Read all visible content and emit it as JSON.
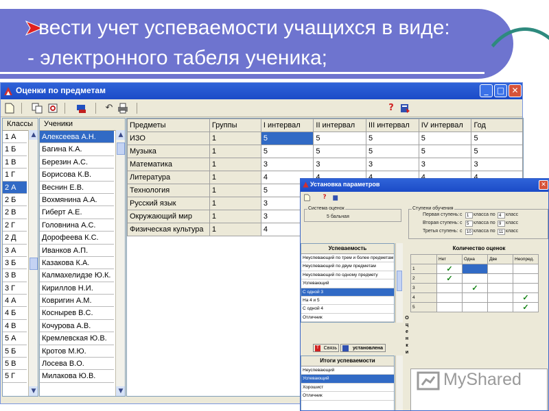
{
  "heading": {
    "line1": "вести учет успеваемости учащихся в виде:",
    "line2": "- электронного табеля ученика;"
  },
  "colors": {
    "banner": "#6e74cf",
    "selection": "#316ac5",
    "titlebar": "#2160d0",
    "check": "#108010",
    "bullet": "#e02020"
  },
  "window": {
    "title": "Оценки по предметам",
    "toolbar_icons": [
      "new-document-icon",
      "copy-icon",
      "refresh-icon",
      "print-preview-icon",
      "undo-icon",
      "printer-icon",
      "help-icon",
      "book-icon"
    ],
    "classes": {
      "header": "Классы",
      "items": [
        "1 А",
        "1 Б",
        "1 В",
        "1 Г",
        "2 А",
        "2 Б",
        "2 В",
        "2 Г",
        "2 Д",
        "3 А",
        "3 Б",
        "3 В",
        "3 Г",
        "4 А",
        "4 Б",
        "4 В",
        "5 А",
        "5 Б",
        "5 В",
        "5 Г"
      ],
      "selected": "2 А"
    },
    "students": {
      "header": "Ученики",
      "items": [
        "Алексеева А.Н.",
        "Багина К.А.",
        "Березин А.С.",
        "Борисова К.В.",
        "Веснин Е.В.",
        "Вохмянина А.А.",
        "Гиберт А.Е.",
        "Головнина А.С.",
        "Дорофеева К.С.",
        "Иванков А.П.",
        "Казакова К.А.",
        "Калмахелидзе Ю.К.",
        "Кириллов Н.И.",
        "Ковригин А.М.",
        "Коснырев В.С.",
        "Кочурова А.В.",
        "Кремлевская Ю.В.",
        "Кротов М.Ю.",
        "Лосева В.О.",
        "Милакова Ю.В."
      ],
      "selected": "Алексеева А.Н."
    },
    "grades": {
      "columns": [
        "Предметы",
        "Группы",
        "I интервал",
        "II интервал",
        "III интервал",
        "IV интервал",
        "Год"
      ],
      "rows": [
        [
          "ИЗО",
          "1",
          "5",
          "5",
          "5",
          "5",
          "5"
        ],
        [
          "Музыка",
          "1",
          "5",
          "5",
          "5",
          "5",
          "5"
        ],
        [
          "Математика",
          "1",
          "3",
          "3",
          "3",
          "3",
          "3"
        ],
        [
          "Литература",
          "1",
          "4",
          "4",
          "4",
          "4",
          "4"
        ],
        [
          "Технология",
          "1",
          "5",
          "",
          "",
          "",
          ""
        ],
        [
          "Русский язык",
          "1",
          "3",
          "",
          "",
          "",
          ""
        ],
        [
          "Окружающий мир",
          "1",
          "3",
          "",
          "",
          "",
          ""
        ],
        [
          "Физическая культура",
          "1",
          "4",
          "",
          "",
          "",
          ""
        ]
      ]
    }
  },
  "dialog": {
    "title": "Установка параметров",
    "grading_system": {
      "label": "Система оценок",
      "value": "5 бальная"
    },
    "levels": {
      "label": "Ступени обучения",
      "rows": [
        {
          "name": "Первая ступень:",
          "from_label": "с",
          "from": "1",
          "mid": "класса по",
          "to": "4",
          "unit": "класс"
        },
        {
          "name": "Вторая ступень:",
          "from_label": "с",
          "from": "5",
          "mid": "класса по",
          "to": "9",
          "unit": "класс"
        },
        {
          "name": "Третья ступень:",
          "from_label": "с",
          "from": "10",
          "mid": "класса по",
          "to": "11",
          "unit": "класс"
        }
      ]
    },
    "performance": {
      "header": "Успеваемость",
      "items": [
        "Неуспевающий по трем и более предметам",
        "Неуспевающий по двум предметам",
        "Неуспевающий по одному предмету",
        "Успевающий",
        "С одной 3",
        "На 4 и 5",
        "С одной 4",
        "Отличник"
      ],
      "selected": "С одной 3"
    },
    "counts": {
      "header": "Количество оценок",
      "columns": [
        "Нет",
        "Одна",
        "Две",
        "Неопред."
      ],
      "rows": [
        {
          "label": "1",
          "checks": [
            true,
            false,
            false,
            false
          ]
        },
        {
          "label": "2",
          "checks": [
            true,
            false,
            false,
            false
          ]
        },
        {
          "label": "3",
          "checks": [
            false,
            true,
            false,
            false
          ]
        },
        {
          "label": "4",
          "checks": [
            false,
            false,
            false,
            true
          ]
        },
        {
          "label": "5",
          "checks": [
            false,
            false,
            false,
            true
          ]
        }
      ]
    },
    "vertical_label": [
      "О",
      "ц",
      "е",
      "н",
      "к",
      "и"
    ],
    "link_button": "Связь",
    "installed_button": "установлена",
    "results": {
      "header": "Итоги успеваемости",
      "items": [
        "Неуспевающий",
        "Успевающий",
        "Хорошист",
        "Отличник"
      ],
      "selected": "Успевающий"
    }
  },
  "watermark": "MyShared"
}
